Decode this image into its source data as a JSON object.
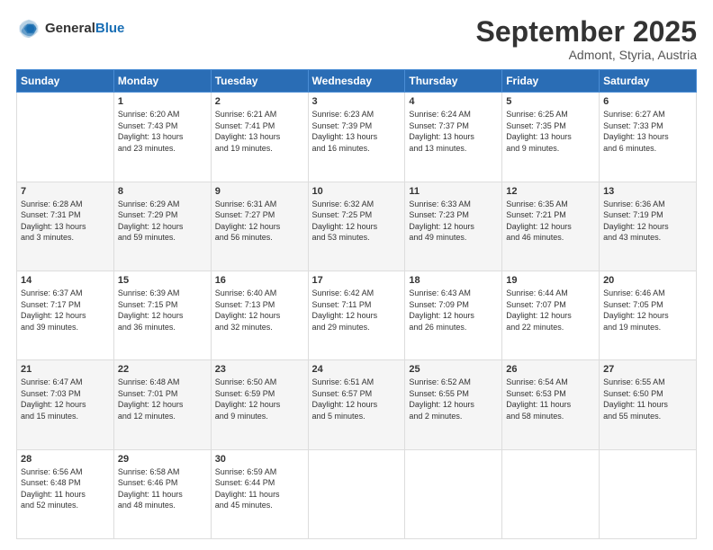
{
  "header": {
    "logo_general": "General",
    "logo_blue": "Blue",
    "month": "September 2025",
    "location": "Admont, Styria, Austria"
  },
  "days_of_week": [
    "Sunday",
    "Monday",
    "Tuesday",
    "Wednesday",
    "Thursday",
    "Friday",
    "Saturday"
  ],
  "weeks": [
    [
      {
        "day": "",
        "info": ""
      },
      {
        "day": "1",
        "info": "Sunrise: 6:20 AM\nSunset: 7:43 PM\nDaylight: 13 hours\nand 23 minutes."
      },
      {
        "day": "2",
        "info": "Sunrise: 6:21 AM\nSunset: 7:41 PM\nDaylight: 13 hours\nand 19 minutes."
      },
      {
        "day": "3",
        "info": "Sunrise: 6:23 AM\nSunset: 7:39 PM\nDaylight: 13 hours\nand 16 minutes."
      },
      {
        "day": "4",
        "info": "Sunrise: 6:24 AM\nSunset: 7:37 PM\nDaylight: 13 hours\nand 13 minutes."
      },
      {
        "day": "5",
        "info": "Sunrise: 6:25 AM\nSunset: 7:35 PM\nDaylight: 13 hours\nand 9 minutes."
      },
      {
        "day": "6",
        "info": "Sunrise: 6:27 AM\nSunset: 7:33 PM\nDaylight: 13 hours\nand 6 minutes."
      }
    ],
    [
      {
        "day": "7",
        "info": "Sunrise: 6:28 AM\nSunset: 7:31 PM\nDaylight: 13 hours\nand 3 minutes."
      },
      {
        "day": "8",
        "info": "Sunrise: 6:29 AM\nSunset: 7:29 PM\nDaylight: 12 hours\nand 59 minutes."
      },
      {
        "day": "9",
        "info": "Sunrise: 6:31 AM\nSunset: 7:27 PM\nDaylight: 12 hours\nand 56 minutes."
      },
      {
        "day": "10",
        "info": "Sunrise: 6:32 AM\nSunset: 7:25 PM\nDaylight: 12 hours\nand 53 minutes."
      },
      {
        "day": "11",
        "info": "Sunrise: 6:33 AM\nSunset: 7:23 PM\nDaylight: 12 hours\nand 49 minutes."
      },
      {
        "day": "12",
        "info": "Sunrise: 6:35 AM\nSunset: 7:21 PM\nDaylight: 12 hours\nand 46 minutes."
      },
      {
        "day": "13",
        "info": "Sunrise: 6:36 AM\nSunset: 7:19 PM\nDaylight: 12 hours\nand 43 minutes."
      }
    ],
    [
      {
        "day": "14",
        "info": "Sunrise: 6:37 AM\nSunset: 7:17 PM\nDaylight: 12 hours\nand 39 minutes."
      },
      {
        "day": "15",
        "info": "Sunrise: 6:39 AM\nSunset: 7:15 PM\nDaylight: 12 hours\nand 36 minutes."
      },
      {
        "day": "16",
        "info": "Sunrise: 6:40 AM\nSunset: 7:13 PM\nDaylight: 12 hours\nand 32 minutes."
      },
      {
        "day": "17",
        "info": "Sunrise: 6:42 AM\nSunset: 7:11 PM\nDaylight: 12 hours\nand 29 minutes."
      },
      {
        "day": "18",
        "info": "Sunrise: 6:43 AM\nSunset: 7:09 PM\nDaylight: 12 hours\nand 26 minutes."
      },
      {
        "day": "19",
        "info": "Sunrise: 6:44 AM\nSunset: 7:07 PM\nDaylight: 12 hours\nand 22 minutes."
      },
      {
        "day": "20",
        "info": "Sunrise: 6:46 AM\nSunset: 7:05 PM\nDaylight: 12 hours\nand 19 minutes."
      }
    ],
    [
      {
        "day": "21",
        "info": "Sunrise: 6:47 AM\nSunset: 7:03 PM\nDaylight: 12 hours\nand 15 minutes."
      },
      {
        "day": "22",
        "info": "Sunrise: 6:48 AM\nSunset: 7:01 PM\nDaylight: 12 hours\nand 12 minutes."
      },
      {
        "day": "23",
        "info": "Sunrise: 6:50 AM\nSunset: 6:59 PM\nDaylight: 12 hours\nand 9 minutes."
      },
      {
        "day": "24",
        "info": "Sunrise: 6:51 AM\nSunset: 6:57 PM\nDaylight: 12 hours\nand 5 minutes."
      },
      {
        "day": "25",
        "info": "Sunrise: 6:52 AM\nSunset: 6:55 PM\nDaylight: 12 hours\nand 2 minutes."
      },
      {
        "day": "26",
        "info": "Sunrise: 6:54 AM\nSunset: 6:53 PM\nDaylight: 11 hours\nand 58 minutes."
      },
      {
        "day": "27",
        "info": "Sunrise: 6:55 AM\nSunset: 6:50 PM\nDaylight: 11 hours\nand 55 minutes."
      }
    ],
    [
      {
        "day": "28",
        "info": "Sunrise: 6:56 AM\nSunset: 6:48 PM\nDaylight: 11 hours\nand 52 minutes."
      },
      {
        "day": "29",
        "info": "Sunrise: 6:58 AM\nSunset: 6:46 PM\nDaylight: 11 hours\nand 48 minutes."
      },
      {
        "day": "30",
        "info": "Sunrise: 6:59 AM\nSunset: 6:44 PM\nDaylight: 11 hours\nand 45 minutes."
      },
      {
        "day": "",
        "info": ""
      },
      {
        "day": "",
        "info": ""
      },
      {
        "day": "",
        "info": ""
      },
      {
        "day": "",
        "info": ""
      }
    ]
  ]
}
